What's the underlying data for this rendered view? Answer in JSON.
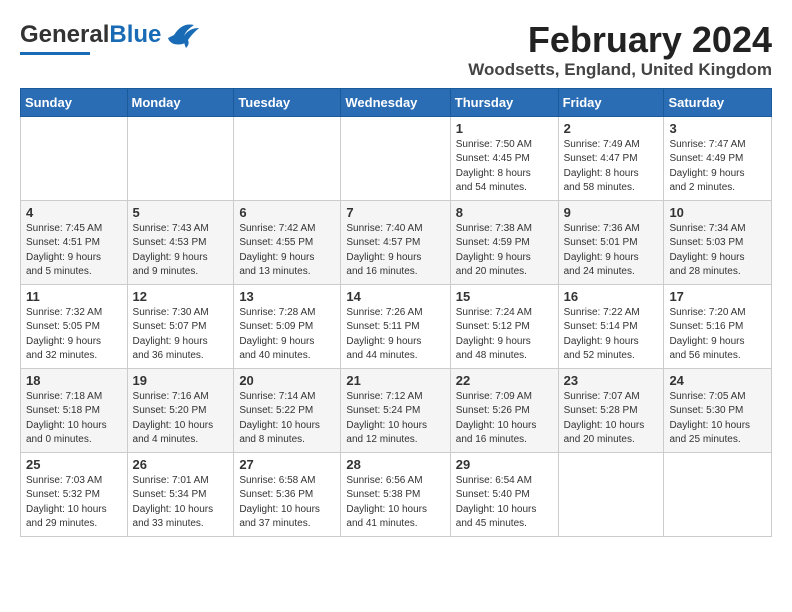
{
  "header": {
    "logo_general": "General",
    "logo_blue": "Blue",
    "month": "February 2024",
    "location": "Woodsetts, England, United Kingdom"
  },
  "days_of_week": [
    "Sunday",
    "Monday",
    "Tuesday",
    "Wednesday",
    "Thursday",
    "Friday",
    "Saturday"
  ],
  "weeks": [
    [
      {
        "day": "",
        "info": ""
      },
      {
        "day": "",
        "info": ""
      },
      {
        "day": "",
        "info": ""
      },
      {
        "day": "",
        "info": ""
      },
      {
        "day": "1",
        "info": "Sunrise: 7:50 AM\nSunset: 4:45 PM\nDaylight: 8 hours\nand 54 minutes."
      },
      {
        "day": "2",
        "info": "Sunrise: 7:49 AM\nSunset: 4:47 PM\nDaylight: 8 hours\nand 58 minutes."
      },
      {
        "day": "3",
        "info": "Sunrise: 7:47 AM\nSunset: 4:49 PM\nDaylight: 9 hours\nand 2 minutes."
      }
    ],
    [
      {
        "day": "4",
        "info": "Sunrise: 7:45 AM\nSunset: 4:51 PM\nDaylight: 9 hours\nand 5 minutes."
      },
      {
        "day": "5",
        "info": "Sunrise: 7:43 AM\nSunset: 4:53 PM\nDaylight: 9 hours\nand 9 minutes."
      },
      {
        "day": "6",
        "info": "Sunrise: 7:42 AM\nSunset: 4:55 PM\nDaylight: 9 hours\nand 13 minutes."
      },
      {
        "day": "7",
        "info": "Sunrise: 7:40 AM\nSunset: 4:57 PM\nDaylight: 9 hours\nand 16 minutes."
      },
      {
        "day": "8",
        "info": "Sunrise: 7:38 AM\nSunset: 4:59 PM\nDaylight: 9 hours\nand 20 minutes."
      },
      {
        "day": "9",
        "info": "Sunrise: 7:36 AM\nSunset: 5:01 PM\nDaylight: 9 hours\nand 24 minutes."
      },
      {
        "day": "10",
        "info": "Sunrise: 7:34 AM\nSunset: 5:03 PM\nDaylight: 9 hours\nand 28 minutes."
      }
    ],
    [
      {
        "day": "11",
        "info": "Sunrise: 7:32 AM\nSunset: 5:05 PM\nDaylight: 9 hours\nand 32 minutes."
      },
      {
        "day": "12",
        "info": "Sunrise: 7:30 AM\nSunset: 5:07 PM\nDaylight: 9 hours\nand 36 minutes."
      },
      {
        "day": "13",
        "info": "Sunrise: 7:28 AM\nSunset: 5:09 PM\nDaylight: 9 hours\nand 40 minutes."
      },
      {
        "day": "14",
        "info": "Sunrise: 7:26 AM\nSunset: 5:11 PM\nDaylight: 9 hours\nand 44 minutes."
      },
      {
        "day": "15",
        "info": "Sunrise: 7:24 AM\nSunset: 5:12 PM\nDaylight: 9 hours\nand 48 minutes."
      },
      {
        "day": "16",
        "info": "Sunrise: 7:22 AM\nSunset: 5:14 PM\nDaylight: 9 hours\nand 52 minutes."
      },
      {
        "day": "17",
        "info": "Sunrise: 7:20 AM\nSunset: 5:16 PM\nDaylight: 9 hours\nand 56 minutes."
      }
    ],
    [
      {
        "day": "18",
        "info": "Sunrise: 7:18 AM\nSunset: 5:18 PM\nDaylight: 10 hours\nand 0 minutes."
      },
      {
        "day": "19",
        "info": "Sunrise: 7:16 AM\nSunset: 5:20 PM\nDaylight: 10 hours\nand 4 minutes."
      },
      {
        "day": "20",
        "info": "Sunrise: 7:14 AM\nSunset: 5:22 PM\nDaylight: 10 hours\nand 8 minutes."
      },
      {
        "day": "21",
        "info": "Sunrise: 7:12 AM\nSunset: 5:24 PM\nDaylight: 10 hours\nand 12 minutes."
      },
      {
        "day": "22",
        "info": "Sunrise: 7:09 AM\nSunset: 5:26 PM\nDaylight: 10 hours\nand 16 minutes."
      },
      {
        "day": "23",
        "info": "Sunrise: 7:07 AM\nSunset: 5:28 PM\nDaylight: 10 hours\nand 20 minutes."
      },
      {
        "day": "24",
        "info": "Sunrise: 7:05 AM\nSunset: 5:30 PM\nDaylight: 10 hours\nand 25 minutes."
      }
    ],
    [
      {
        "day": "25",
        "info": "Sunrise: 7:03 AM\nSunset: 5:32 PM\nDaylight: 10 hours\nand 29 minutes."
      },
      {
        "day": "26",
        "info": "Sunrise: 7:01 AM\nSunset: 5:34 PM\nDaylight: 10 hours\nand 33 minutes."
      },
      {
        "day": "27",
        "info": "Sunrise: 6:58 AM\nSunset: 5:36 PM\nDaylight: 10 hours\nand 37 minutes."
      },
      {
        "day": "28",
        "info": "Sunrise: 6:56 AM\nSunset: 5:38 PM\nDaylight: 10 hours\nand 41 minutes."
      },
      {
        "day": "29",
        "info": "Sunrise: 6:54 AM\nSunset: 5:40 PM\nDaylight: 10 hours\nand 45 minutes."
      },
      {
        "day": "",
        "info": ""
      },
      {
        "day": "",
        "info": ""
      }
    ]
  ]
}
